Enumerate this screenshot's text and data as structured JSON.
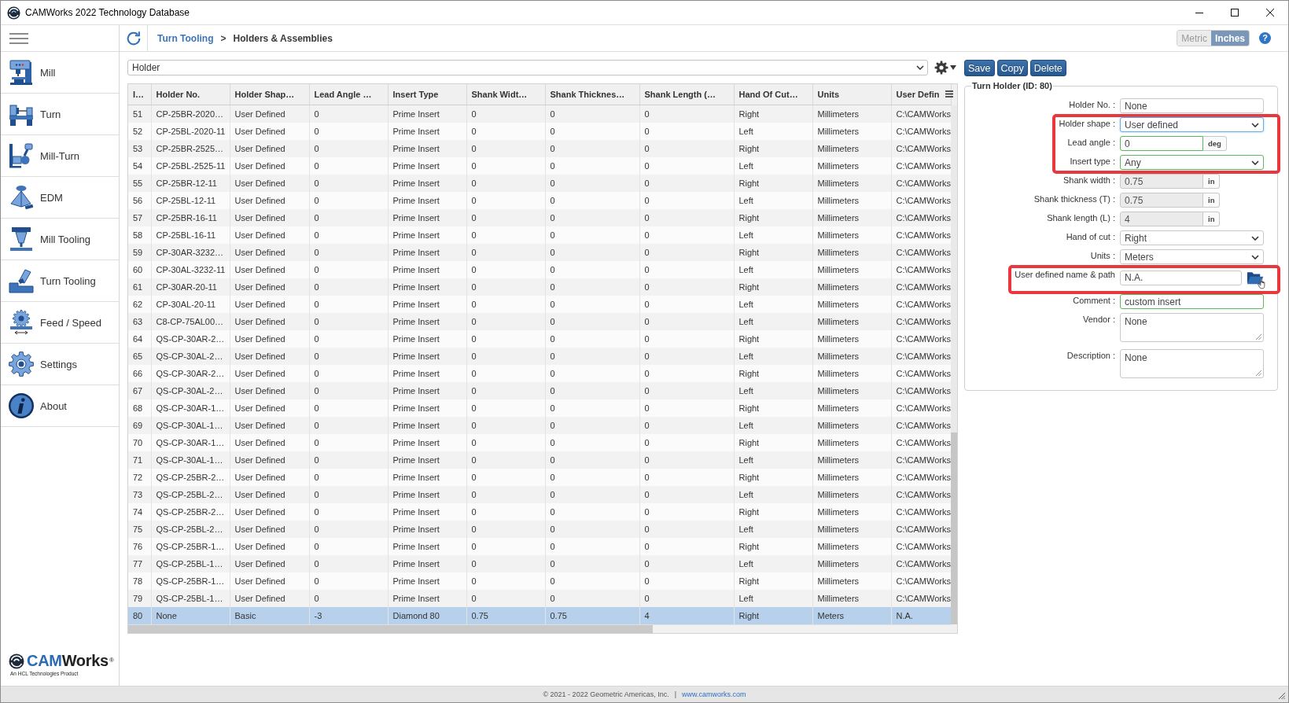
{
  "window": {
    "title": "CAMWorks 2022 Technology Database"
  },
  "sidebar": {
    "items": [
      {
        "label": "Mill"
      },
      {
        "label": "Turn"
      },
      {
        "label": "Mill-Turn"
      },
      {
        "label": "EDM"
      },
      {
        "label": "Mill Tooling"
      },
      {
        "label": "Turn Tooling"
      },
      {
        "label": "Feed / Speed"
      },
      {
        "label": "Settings"
      },
      {
        "label": "About"
      }
    ],
    "logo": {
      "wordmark_accent": "CAM",
      "wordmark_rest": "Works",
      "registered": "®",
      "tagline": "An HCL Technologies Product"
    }
  },
  "breadcrumb": [
    {
      "label": "Turn Tooling",
      "kind": "link"
    },
    {
      "label": ">",
      "kind": "separator"
    },
    {
      "label": "Holders & Assemblies",
      "kind": "current"
    }
  ],
  "unit_toggle": [
    {
      "label": "Metric",
      "selected": false
    },
    {
      "label": "Inches",
      "selected": true
    }
  ],
  "help_button": {
    "label": "?"
  },
  "category_select": {
    "value": "Holder"
  },
  "table": {
    "columns": [
      "I…",
      "Holder No.",
      "Holder Shap…",
      "Lead Angle …",
      "Insert Type",
      "Shank Widt…",
      "Shank Thicknes…",
      "Shank Length (…",
      "Hand Of Cut…",
      "Units",
      "User Defin"
    ],
    "rows": [
      {
        "selected": false,
        "cells": [
          "51",
          "CP-25BR-2020…",
          "User Defined",
          "0",
          "Prime Insert",
          "0",
          "0",
          "0",
          "Right",
          "Millimeters",
          "C:\\CAMWorks"
        ]
      },
      {
        "selected": false,
        "cells": [
          "52",
          "CP-25BL-2020-11",
          "User Defined",
          "0",
          "Prime Insert",
          "0",
          "0",
          "0",
          "Left",
          "Millimeters",
          "C:\\CAMWorks"
        ]
      },
      {
        "selected": false,
        "cells": [
          "53",
          "CP-25BR-2525…",
          "User Defined",
          "0",
          "Prime Insert",
          "0",
          "0",
          "0",
          "Right",
          "Millimeters",
          "C:\\CAMWorks"
        ]
      },
      {
        "selected": false,
        "cells": [
          "54",
          "CP-25BL-2525-11",
          "User Defined",
          "0",
          "Prime Insert",
          "0",
          "0",
          "0",
          "Left",
          "Millimeters",
          "C:\\CAMWorks"
        ]
      },
      {
        "selected": false,
        "cells": [
          "55",
          "CP-25BR-12-11",
          "User Defined",
          "0",
          "Prime Insert",
          "0",
          "0",
          "0",
          "Right",
          "Millimeters",
          "C:\\CAMWorks"
        ]
      },
      {
        "selected": false,
        "cells": [
          "56",
          "CP-25BL-12-11",
          "User Defined",
          "0",
          "Prime Insert",
          "0",
          "0",
          "0",
          "Left",
          "Millimeters",
          "C:\\CAMWorks"
        ]
      },
      {
        "selected": false,
        "cells": [
          "57",
          "CP-25BR-16-11",
          "User Defined",
          "0",
          "Prime Insert",
          "0",
          "0",
          "0",
          "Right",
          "Millimeters",
          "C:\\CAMWorks"
        ]
      },
      {
        "selected": false,
        "cells": [
          "58",
          "CP-25BL-16-11",
          "User Defined",
          "0",
          "Prime Insert",
          "0",
          "0",
          "0",
          "Left",
          "Millimeters",
          "C:\\CAMWorks"
        ]
      },
      {
        "selected": false,
        "cells": [
          "59",
          "CP-30AR-3232…",
          "User Defined",
          "0",
          "Prime Insert",
          "0",
          "0",
          "0",
          "Right",
          "Millimeters",
          "C:\\CAMWorks"
        ]
      },
      {
        "selected": false,
        "cells": [
          "60",
          "CP-30AL-3232-11",
          "User Defined",
          "0",
          "Prime Insert",
          "0",
          "0",
          "0",
          "Left",
          "Millimeters",
          "C:\\CAMWorks"
        ]
      },
      {
        "selected": false,
        "cells": [
          "61",
          "CP-30AR-20-11",
          "User Defined",
          "0",
          "Prime Insert",
          "0",
          "0",
          "0",
          "Right",
          "Millimeters",
          "C:\\CAMWorks"
        ]
      },
      {
        "selected": false,
        "cells": [
          "62",
          "CP-30AL-20-11",
          "User Defined",
          "0",
          "Prime Insert",
          "0",
          "0",
          "0",
          "Left",
          "Millimeters",
          "C:\\CAMWorks"
        ]
      },
      {
        "selected": false,
        "cells": [
          "63",
          "C8-CP-75AL00…",
          "User Defined",
          "0",
          "Prime Insert",
          "0",
          "0",
          "0",
          "Left",
          "Millimeters",
          "C:\\CAMWorks"
        ]
      },
      {
        "selected": false,
        "cells": [
          "64",
          "QS-CP-30AR-2…",
          "User Defined",
          "0",
          "Prime Insert",
          "0",
          "0",
          "0",
          "Right",
          "Millimeters",
          "C:\\CAMWorks"
        ]
      },
      {
        "selected": false,
        "cells": [
          "65",
          "QS-CP-30AL-2…",
          "User Defined",
          "0",
          "Prime Insert",
          "0",
          "0",
          "0",
          "Left",
          "Millimeters",
          "C:\\CAMWorks"
        ]
      },
      {
        "selected": false,
        "cells": [
          "66",
          "QS-CP-30AR-2…",
          "User Defined",
          "0",
          "Prime Insert",
          "0",
          "0",
          "0",
          "Right",
          "Millimeters",
          "C:\\CAMWorks"
        ]
      },
      {
        "selected": false,
        "cells": [
          "67",
          "QS-CP-30AL-2…",
          "User Defined",
          "0",
          "Prime Insert",
          "0",
          "0",
          "0",
          "Left",
          "Millimeters",
          "C:\\CAMWorks"
        ]
      },
      {
        "selected": false,
        "cells": [
          "68",
          "QS-CP-30AR-1…",
          "User Defined",
          "0",
          "Prime Insert",
          "0",
          "0",
          "0",
          "Right",
          "Millimeters",
          "C:\\CAMWorks"
        ]
      },
      {
        "selected": false,
        "cells": [
          "69",
          "QS-CP-30AL-1…",
          "User Defined",
          "0",
          "Prime Insert",
          "0",
          "0",
          "0",
          "Left",
          "Millimeters",
          "C:\\CAMWorks"
        ]
      },
      {
        "selected": false,
        "cells": [
          "70",
          "QS-CP-30AR-1…",
          "User Defined",
          "0",
          "Prime Insert",
          "0",
          "0",
          "0",
          "Right",
          "Millimeters",
          "C:\\CAMWorks"
        ]
      },
      {
        "selected": false,
        "cells": [
          "71",
          "QS-CP-30AL-1…",
          "User Defined",
          "0",
          "Prime Insert",
          "0",
          "0",
          "0",
          "Left",
          "Millimeters",
          "C:\\CAMWorks"
        ]
      },
      {
        "selected": false,
        "cells": [
          "72",
          "QS-CP-25BR-2…",
          "User Defined",
          "0",
          "Prime Insert",
          "0",
          "0",
          "0",
          "Right",
          "Millimeters",
          "C:\\CAMWorks"
        ]
      },
      {
        "selected": false,
        "cells": [
          "73",
          "QS-CP-25BL-2…",
          "User Defined",
          "0",
          "Prime Insert",
          "0",
          "0",
          "0",
          "Left",
          "Millimeters",
          "C:\\CAMWorks"
        ]
      },
      {
        "selected": false,
        "cells": [
          "74",
          "QS-CP-25BR-2…",
          "User Defined",
          "0",
          "Prime Insert",
          "0",
          "0",
          "0",
          "Right",
          "Millimeters",
          "C:\\CAMWorks"
        ]
      },
      {
        "selected": false,
        "cells": [
          "75",
          "QS-CP-25BL-2…",
          "User Defined",
          "0",
          "Prime Insert",
          "0",
          "0",
          "0",
          "Left",
          "Millimeters",
          "C:\\CAMWorks"
        ]
      },
      {
        "selected": false,
        "cells": [
          "76",
          "QS-CP-25BR-1…",
          "User Defined",
          "0",
          "Prime Insert",
          "0",
          "0",
          "0",
          "Right",
          "Millimeters",
          "C:\\CAMWorks"
        ]
      },
      {
        "selected": false,
        "cells": [
          "77",
          "QS-CP-25BL-1…",
          "User Defined",
          "0",
          "Prime Insert",
          "0",
          "0",
          "0",
          "Left",
          "Millimeters",
          "C:\\CAMWorks"
        ]
      },
      {
        "selected": false,
        "cells": [
          "78",
          "QS-CP-25BR-1…",
          "User Defined",
          "0",
          "Prime Insert",
          "0",
          "0",
          "0",
          "Right",
          "Millimeters",
          "C:\\CAMWorks"
        ]
      },
      {
        "selected": false,
        "cells": [
          "79",
          "QS-CP-25BL-1…",
          "User Defined",
          "0",
          "Prime Insert",
          "0",
          "0",
          "0",
          "Left",
          "Millimeters",
          "C:\\CAMWorks"
        ]
      },
      {
        "selected": true,
        "cells": [
          "80",
          "None",
          "Basic",
          "-3",
          "Diamond 80",
          "0.75",
          "0.75",
          "4",
          "Right",
          "Meters",
          "N.A."
        ]
      }
    ]
  },
  "actions": [
    "Save",
    "Copy",
    "Delete"
  ],
  "form": {
    "legend": "Turn Holder (ID: 80)",
    "groups": [
      {
        "highlighted": false,
        "fields": [
          {
            "label": "Holder No. :",
            "kind": "text",
            "value": "None",
            "disabled": false,
            "focused": false,
            "valid": false
          }
        ]
      },
      {
        "highlighted": true,
        "fields": [
          {
            "label": "Holder shape :",
            "kind": "select",
            "value": "User defined",
            "disabled": false,
            "focused": true,
            "valid": false
          },
          {
            "label": "Lead angle :",
            "kind": "unit",
            "value": "0",
            "unit": "deg",
            "disabled": false,
            "focused": false,
            "valid": true
          },
          {
            "label": "Insert type :",
            "kind": "select",
            "value": "Any",
            "disabled": false,
            "focused": false,
            "valid": true
          }
        ]
      },
      {
        "highlighted": false,
        "fields": [
          {
            "label": "Shank width :",
            "kind": "unit",
            "value": "0.75",
            "unit": "in",
            "disabled": true,
            "focused": false,
            "valid": false
          },
          {
            "label": "Shank thickness (T) :",
            "kind": "unit",
            "value": "0.75",
            "unit": "in",
            "disabled": true,
            "focused": false,
            "valid": false
          },
          {
            "label": "Shank length (L) :",
            "kind": "unit",
            "value": "4",
            "unit": "in",
            "disabled": true,
            "focused": false,
            "valid": false
          },
          {
            "label": "Hand of cut :",
            "kind": "select",
            "value": "Right",
            "disabled": false,
            "focused": false,
            "valid": false
          },
          {
            "label": "Units :",
            "kind": "select",
            "value": "Meters",
            "disabled": false,
            "focused": false,
            "valid": false
          }
        ]
      },
      {
        "highlighted": true,
        "fields": [
          {
            "label": "User defined name & path",
            "kind": "path",
            "value": "N.A.",
            "disabled": false,
            "focused": false,
            "valid": false
          }
        ]
      },
      {
        "highlighted": false,
        "fields": [
          {
            "label": "Comment :",
            "kind": "text",
            "value": "custom insert",
            "disabled": false,
            "focused": false,
            "valid": true
          },
          {
            "label": "Vendor :",
            "kind": "textarea",
            "value": "None",
            "disabled": false,
            "focused": false,
            "valid": false
          },
          {
            "label": "Description :",
            "kind": "textarea",
            "value": "None",
            "disabled": false,
            "focused": false,
            "valid": false
          }
        ]
      }
    ]
  },
  "footer": {
    "copyright": "© 2021 - 2022 Geometric Americas, Inc.",
    "separator": "|",
    "link": "www.camworks.com"
  }
}
